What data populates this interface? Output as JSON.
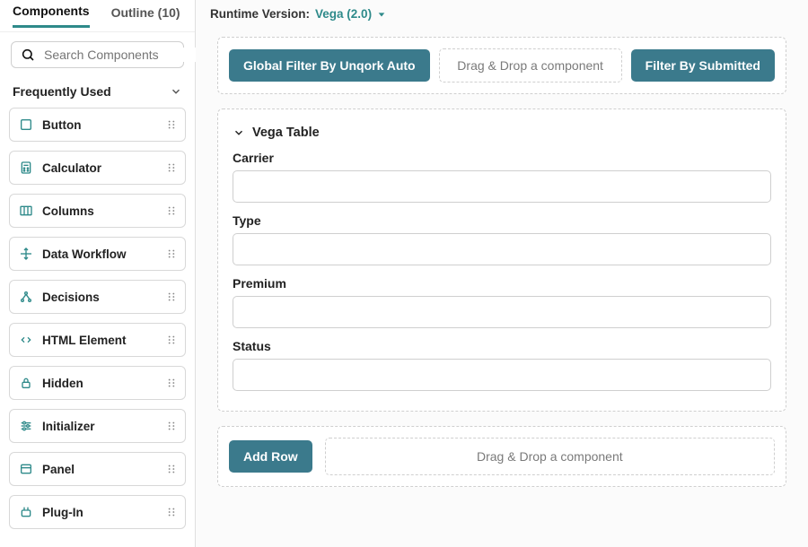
{
  "sidebar": {
    "tabs": {
      "components": "Components",
      "outline": "Outline (10)"
    },
    "search_placeholder": "Search Components",
    "section_title": "Frequently Used",
    "items": [
      {
        "label": "Button"
      },
      {
        "label": "Calculator"
      },
      {
        "label": "Columns"
      },
      {
        "label": "Data Workflow"
      },
      {
        "label": "Decisions"
      },
      {
        "label": "HTML Element"
      },
      {
        "label": "Hidden"
      },
      {
        "label": "Initializer"
      },
      {
        "label": "Panel"
      },
      {
        "label": "Plug-In"
      }
    ]
  },
  "header": {
    "runtime_label": "Runtime Version:",
    "runtime_value": "Vega (2.0)"
  },
  "canvas": {
    "top": {
      "global_filter": "Global Filter By Unqork Auto",
      "drop_text": "Drag & Drop a component",
      "filter_submitted": "Filter By Submitted"
    },
    "vega_table": {
      "title": "Vega Table",
      "fields": [
        {
          "label": "Carrier"
        },
        {
          "label": "Type"
        },
        {
          "label": "Premium"
        },
        {
          "label": "Status"
        }
      ]
    },
    "bottom": {
      "add_row": "Add Row",
      "drop_text": "Drag & Drop a component"
    }
  }
}
